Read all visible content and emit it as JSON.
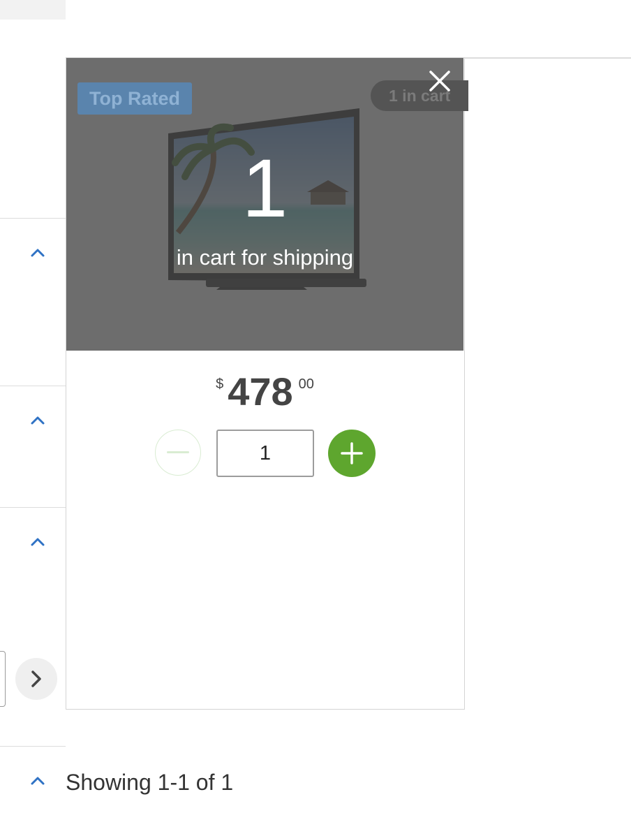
{
  "product": {
    "badge_top": "Top Rated",
    "badge_cart": "1 in cart",
    "cart_count": "1",
    "cart_label": "in cart for shipping",
    "price": {
      "currency": "$",
      "dollars": "478",
      "cents": "00"
    },
    "quantity": "1",
    "image_alt": "Television"
  },
  "pagination": {
    "showing": "Showing 1-1 of 1"
  },
  "colors": {
    "accent_blue": "#2f72c4",
    "add_green": "#5ea62e"
  },
  "icons": {
    "close": "close-icon",
    "minus": "minus-icon",
    "plus": "plus-icon",
    "next": "chevron-right-icon",
    "collapse": "chevron-up-icon"
  }
}
